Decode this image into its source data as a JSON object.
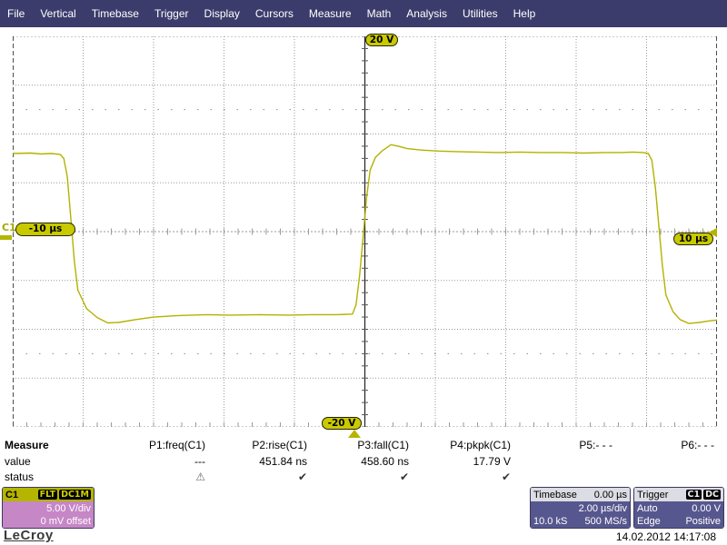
{
  "menu": {
    "items": [
      "File",
      "Vertical",
      "Timebase",
      "Trigger",
      "Display",
      "Cursors",
      "Measure",
      "Math",
      "Analysis",
      "Utilities",
      "Help"
    ]
  },
  "scope": {
    "top_voltage_label": "20 V",
    "bottom_voltage_label": "-20 V",
    "left_time_label": "-10 µs",
    "right_time_label": "10 µs",
    "channel_label": "C1"
  },
  "measure": {
    "title": "Measure",
    "value_row_label": "value",
    "status_row_label": "status",
    "columns": [
      {
        "param": "P1:freq(C1)",
        "value": "---",
        "status_icon": "⚠"
      },
      {
        "param": "P2:rise(C1)",
        "value": "451.84 ns",
        "status_icon": "✔"
      },
      {
        "param": "P3:fall(C1)",
        "value": "458.60 ns",
        "status_icon": "✔"
      },
      {
        "param": "P4:pkpk(C1)",
        "value": "17.79 V",
        "status_icon": "✔"
      },
      {
        "param": "P5:- - -",
        "value": "",
        "status_icon": ""
      },
      {
        "param": "P6:- - -",
        "value": "",
        "status_icon": ""
      }
    ]
  },
  "channel_box": {
    "name": "C1",
    "badge_filter": "FLT",
    "badge_coupling": "DC1M",
    "vdiv": "5.00 V/div",
    "offset": "0 mV offset"
  },
  "timebase_box": {
    "title": "Timebase",
    "delay": "0.00 µs",
    "tdiv": "2.00 µs/div",
    "samples": "10.0 kS",
    "rate": "500 MS/s"
  },
  "trigger_box": {
    "title": "Trigger",
    "badge_source": "C1",
    "badge_coupling": "DC",
    "mode": "Auto",
    "level": "0.00 V",
    "type": "Edge",
    "slope": "Positive"
  },
  "footer": {
    "brand": "LeCroy",
    "datetime": "14.02.2012 14:17:08"
  },
  "colors": {
    "trace": "#b2b200",
    "marker": "#b5b500",
    "pill_bg": "#c9c900",
    "menu_bg": "#3c3c6c",
    "channel_body": "#c687c6",
    "panel_body": "#57578f"
  },
  "chart_data": {
    "type": "line",
    "title": "C1 square wave",
    "x_unit": "µs",
    "y_unit": "V",
    "x_range": [
      -10,
      10
    ],
    "volts_per_div": 5,
    "time_per_div_us": 2,
    "grid_divs": {
      "x": 10,
      "y": 8
    },
    "points": [
      [
        -10,
        8.0
      ],
      [
        -9.5,
        8.05
      ],
      [
        -9.2,
        7.95
      ],
      [
        -8.9,
        8.0
      ],
      [
        -8.65,
        7.9
      ],
      [
        -8.55,
        7.5
      ],
      [
        -8.45,
        5.6
      ],
      [
        -8.35,
        1.4
      ],
      [
        -8.25,
        -3.0
      ],
      [
        -8.15,
        -6.0
      ],
      [
        -7.9,
        -7.9
      ],
      [
        -7.6,
        -8.8
      ],
      [
        -7.3,
        -9.35
      ],
      [
        -7.0,
        -9.3
      ],
      [
        -6.5,
        -9.0
      ],
      [
        -6.0,
        -8.75
      ],
      [
        -5.3,
        -8.6
      ],
      [
        -4.5,
        -8.5
      ],
      [
        -3.8,
        -8.55
      ],
      [
        -3.0,
        -8.5
      ],
      [
        -2.2,
        -8.55
      ],
      [
        -1.5,
        -8.5
      ],
      [
        -0.8,
        -8.5
      ],
      [
        -0.35,
        -8.45
      ],
      [
        -0.25,
        -7.5
      ],
      [
        -0.15,
        -4.5
      ],
      [
        -0.05,
        -0.5
      ],
      [
        0.05,
        3.5
      ],
      [
        0.15,
        6.3
      ],
      [
        0.3,
        7.6
      ],
      [
        0.5,
        8.3
      ],
      [
        0.74,
        8.9
      ],
      [
        0.95,
        8.75
      ],
      [
        1.2,
        8.5
      ],
      [
        1.6,
        8.35
      ],
      [
        2.1,
        8.25
      ],
      [
        2.6,
        8.2
      ],
      [
        3.2,
        8.15
      ],
      [
        3.8,
        8.1
      ],
      [
        4.4,
        8.15
      ],
      [
        5.0,
        8.1
      ],
      [
        5.6,
        8.1
      ],
      [
        6.2,
        8.05
      ],
      [
        6.8,
        8.1
      ],
      [
        7.3,
        8.1
      ],
      [
        7.6,
        8.15
      ],
      [
        7.9,
        8.1
      ],
      [
        8.05,
        8.0
      ],
      [
        8.15,
        7.3
      ],
      [
        8.25,
        4.5
      ],
      [
        8.35,
        0.5
      ],
      [
        8.45,
        -3.5
      ],
      [
        8.55,
        -6.5
      ],
      [
        8.75,
        -8.2
      ],
      [
        8.95,
        -9.0
      ],
      [
        9.2,
        -9.4
      ],
      [
        9.5,
        -9.3
      ],
      [
        9.75,
        -9.15
      ],
      [
        10,
        -9.05
      ]
    ]
  }
}
